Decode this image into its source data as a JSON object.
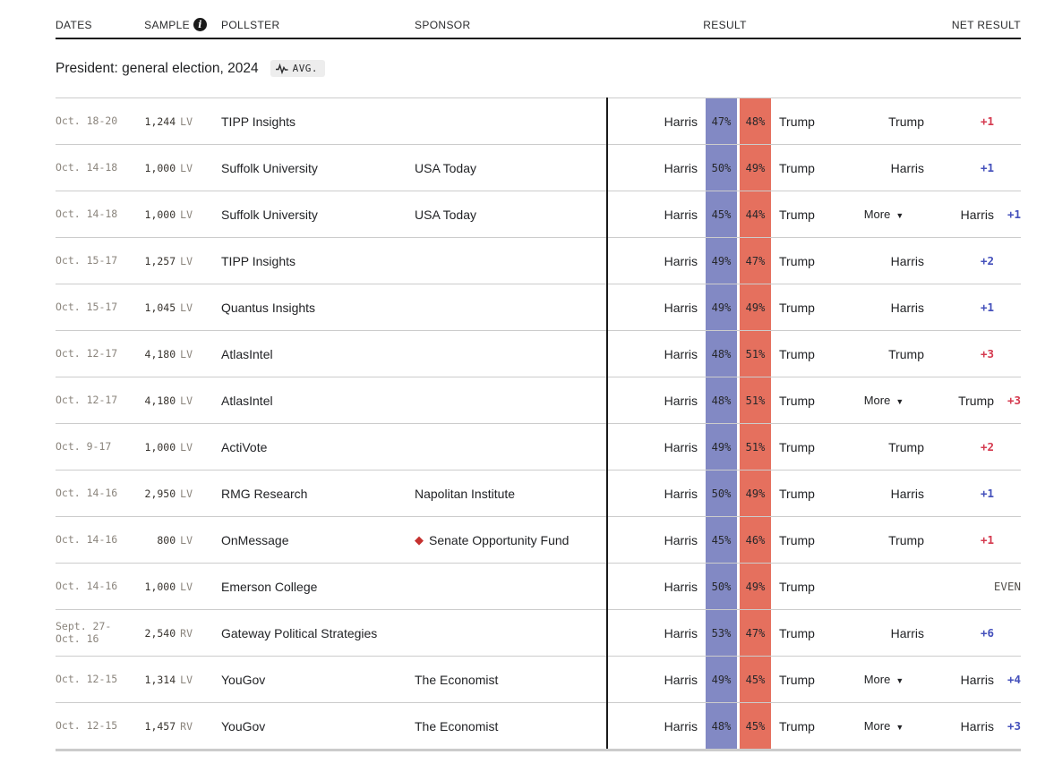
{
  "colors": {
    "harris_cell": "#8289c4",
    "trump_cell": "#e5705e",
    "harris_net": "#4450bb",
    "trump_net": "#d53a4f",
    "diamond": "#c5312f"
  },
  "table_header": {
    "dates": "DATES",
    "sample": "SAMPLE",
    "pollster": "POLLSTER",
    "sponsor": "SPONSOR",
    "result": "RESULT",
    "net_result": "NET RESULT"
  },
  "section": {
    "title": "President: general election, 2024",
    "avg_badge": "AVG."
  },
  "labels": {
    "more": "More",
    "even": "EVEN"
  },
  "icons": {
    "info": "i",
    "dropdown_arrow": "▼",
    "sponsor_diamond": "◆"
  },
  "rows": [
    {
      "dates": "Oct. 18-20",
      "sample": "1,244",
      "sample_type": "LV",
      "pollster": "TIPP Insights",
      "sponsor": "",
      "sponsor_diamond": false,
      "dem_name": "Harris",
      "dem_pct": "47%",
      "rep_pct": "48%",
      "rep_name": "Trump",
      "more": false,
      "net_leader": "Trump",
      "net_value": "+1",
      "even": false
    },
    {
      "dates": "Oct. 14-18",
      "sample": "1,000",
      "sample_type": "LV",
      "pollster": "Suffolk University",
      "sponsor": "USA Today",
      "sponsor_diamond": false,
      "dem_name": "Harris",
      "dem_pct": "50%",
      "rep_pct": "49%",
      "rep_name": "Trump",
      "more": false,
      "net_leader": "Harris",
      "net_value": "+1",
      "even": false
    },
    {
      "dates": "Oct. 14-18",
      "sample": "1,000",
      "sample_type": "LV",
      "pollster": "Suffolk University",
      "sponsor": "USA Today",
      "sponsor_diamond": false,
      "dem_name": "Harris",
      "dem_pct": "45%",
      "rep_pct": "44%",
      "rep_name": "Trump",
      "more": true,
      "net_leader": "Harris",
      "net_value": "+1",
      "even": false
    },
    {
      "dates": "Oct. 15-17",
      "sample": "1,257",
      "sample_type": "LV",
      "pollster": "TIPP Insights",
      "sponsor": "",
      "sponsor_diamond": false,
      "dem_name": "Harris",
      "dem_pct": "49%",
      "rep_pct": "47%",
      "rep_name": "Trump",
      "more": false,
      "net_leader": "Harris",
      "net_value": "+2",
      "even": false
    },
    {
      "dates": "Oct. 15-17",
      "sample": "1,045",
      "sample_type": "LV",
      "pollster": "Quantus Insights",
      "sponsor": "",
      "sponsor_diamond": false,
      "dem_name": "Harris",
      "dem_pct": "49%",
      "rep_pct": "49%",
      "rep_name": "Trump",
      "more": false,
      "net_leader": "Harris",
      "net_value": "+1",
      "even": false
    },
    {
      "dates": "Oct. 12-17",
      "sample": "4,180",
      "sample_type": "LV",
      "pollster": "AtlasIntel",
      "sponsor": "",
      "sponsor_diamond": false,
      "dem_name": "Harris",
      "dem_pct": "48%",
      "rep_pct": "51%",
      "rep_name": "Trump",
      "more": false,
      "net_leader": "Trump",
      "net_value": "+3",
      "even": false
    },
    {
      "dates": "Oct. 12-17",
      "sample": "4,180",
      "sample_type": "LV",
      "pollster": "AtlasIntel",
      "sponsor": "",
      "sponsor_diamond": false,
      "dem_name": "Harris",
      "dem_pct": "48%",
      "rep_pct": "51%",
      "rep_name": "Trump",
      "more": true,
      "net_leader": "Trump",
      "net_value": "+3",
      "even": false
    },
    {
      "dates": "Oct. 9-17",
      "sample": "1,000",
      "sample_type": "LV",
      "pollster": "ActiVote",
      "sponsor": "",
      "sponsor_diamond": false,
      "dem_name": "Harris",
      "dem_pct": "49%",
      "rep_pct": "51%",
      "rep_name": "Trump",
      "more": false,
      "net_leader": "Trump",
      "net_value": "+2",
      "even": false
    },
    {
      "dates": "Oct. 14-16",
      "sample": "2,950",
      "sample_type": "LV",
      "pollster": "RMG Research",
      "sponsor": "Napolitan Institute",
      "sponsor_diamond": false,
      "dem_name": "Harris",
      "dem_pct": "50%",
      "rep_pct": "49%",
      "rep_name": "Trump",
      "more": false,
      "net_leader": "Harris",
      "net_value": "+1",
      "even": false
    },
    {
      "dates": "Oct. 14-16",
      "sample": "800",
      "sample_type": "LV",
      "pollster": "OnMessage",
      "sponsor": "Senate Opportunity Fund",
      "sponsor_diamond": true,
      "dem_name": "Harris",
      "dem_pct": "45%",
      "rep_pct": "46%",
      "rep_name": "Trump",
      "more": false,
      "net_leader": "Trump",
      "net_value": "+1",
      "even": false
    },
    {
      "dates": "Oct. 14-16",
      "sample": "1,000",
      "sample_type": "LV",
      "pollster": "Emerson College",
      "sponsor": "",
      "sponsor_diamond": false,
      "dem_name": "Harris",
      "dem_pct": "50%",
      "rep_pct": "49%",
      "rep_name": "Trump",
      "more": false,
      "net_leader": "",
      "net_value": "",
      "even": true
    },
    {
      "dates": "Sept. 27-\nOct. 16",
      "sample": "2,540",
      "sample_type": "RV",
      "pollster": "Gateway Political Strategies",
      "sponsor": "",
      "sponsor_diamond": false,
      "dem_name": "Harris",
      "dem_pct": "53%",
      "rep_pct": "47%",
      "rep_name": "Trump",
      "more": false,
      "net_leader": "Harris",
      "net_value": "+6",
      "even": false
    },
    {
      "dates": "Oct. 12-15",
      "sample": "1,314",
      "sample_type": "LV",
      "pollster": "YouGov",
      "sponsor": "The Economist",
      "sponsor_diamond": false,
      "dem_name": "Harris",
      "dem_pct": "49%",
      "rep_pct": "45%",
      "rep_name": "Trump",
      "more": true,
      "net_leader": "Harris",
      "net_value": "+4",
      "even": false
    },
    {
      "dates": "Oct. 12-15",
      "sample": "1,457",
      "sample_type": "RV",
      "pollster": "YouGov",
      "sponsor": "The Economist",
      "sponsor_diamond": false,
      "dem_name": "Harris",
      "dem_pct": "48%",
      "rep_pct": "45%",
      "rep_name": "Trump",
      "more": true,
      "net_leader": "Harris",
      "net_value": "+3",
      "even": false
    }
  ]
}
